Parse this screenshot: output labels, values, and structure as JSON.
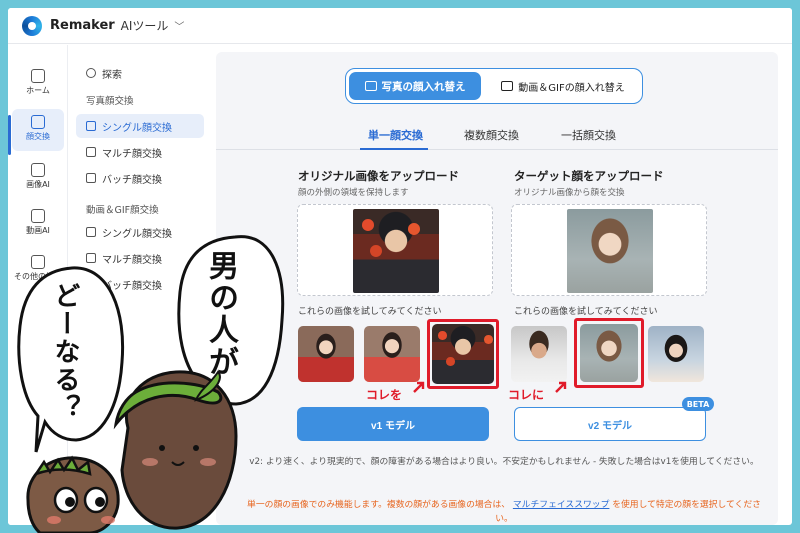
{
  "header": {
    "brand": "Remaker",
    "menu_label": "AIツール",
    "menu_chevron": "﹀"
  },
  "rail": {
    "items": [
      {
        "label": "ホーム",
        "icon": "home-icon"
      },
      {
        "label": "顔交換",
        "icon": "face-swap-icon",
        "active": true
      },
      {
        "label": "画像AI",
        "icon": "image-icon"
      },
      {
        "label": "動画AI",
        "icon": "video-icon"
      },
      {
        "label": "その他の機能",
        "icon": "grid-icon"
      }
    ]
  },
  "sidebar": {
    "search": "探索",
    "photo_section": "写真顔交換",
    "photo_items": [
      "シングル顔交換",
      "マルチ顔交換",
      "バッチ顔交換"
    ],
    "video_section": "動画＆GIF顔交換",
    "video_items": [
      "シングル顔交換",
      "マルチ顔交換",
      "バッチ顔交換"
    ]
  },
  "mode": {
    "photo": "写真の顔入れ替え",
    "video": "動画＆GIFの顔入れ替え"
  },
  "tabs": [
    "単一顔交換",
    "複数顔交換",
    "一括顔交換"
  ],
  "original": {
    "title": "オリジナル画像をアップロード",
    "subtitle": "顔の外側の領域を保持します",
    "try_label": "これらの画像を試してみてください"
  },
  "target": {
    "title": "ターゲット顔をアップロード",
    "subtitle": "オリジナル画像から顔を交換",
    "try_label": "これらの画像を試してみてください"
  },
  "annotations": {
    "kore_wo": "コレを",
    "kore_ni": "コレに"
  },
  "buttons": {
    "v1": "v1 モデル",
    "v2": "v2 モデル",
    "beta": "BETA"
  },
  "notes": {
    "v2_info": "v2: より速く、より現実的で、顔の障害がある場合はより良い。不安定かもしれません - 失敗した場合はv1を使用してください。",
    "single_face_before": "単一の顔の画像でのみ機能します。複数の顔がある画像の場合は、",
    "single_face_link": "マルチフェイススワップ",
    "single_face_after": "を使用して特定の顔を選択してください。"
  },
  "illustration": {
    "bubble_right": "男の人が",
    "bubble_left": "どーなる？"
  },
  "colors": {
    "accent": "#3d8fe0",
    "highlight": "#e01b2a",
    "warning": "#e7651f",
    "frame": "#6cc6d8"
  }
}
